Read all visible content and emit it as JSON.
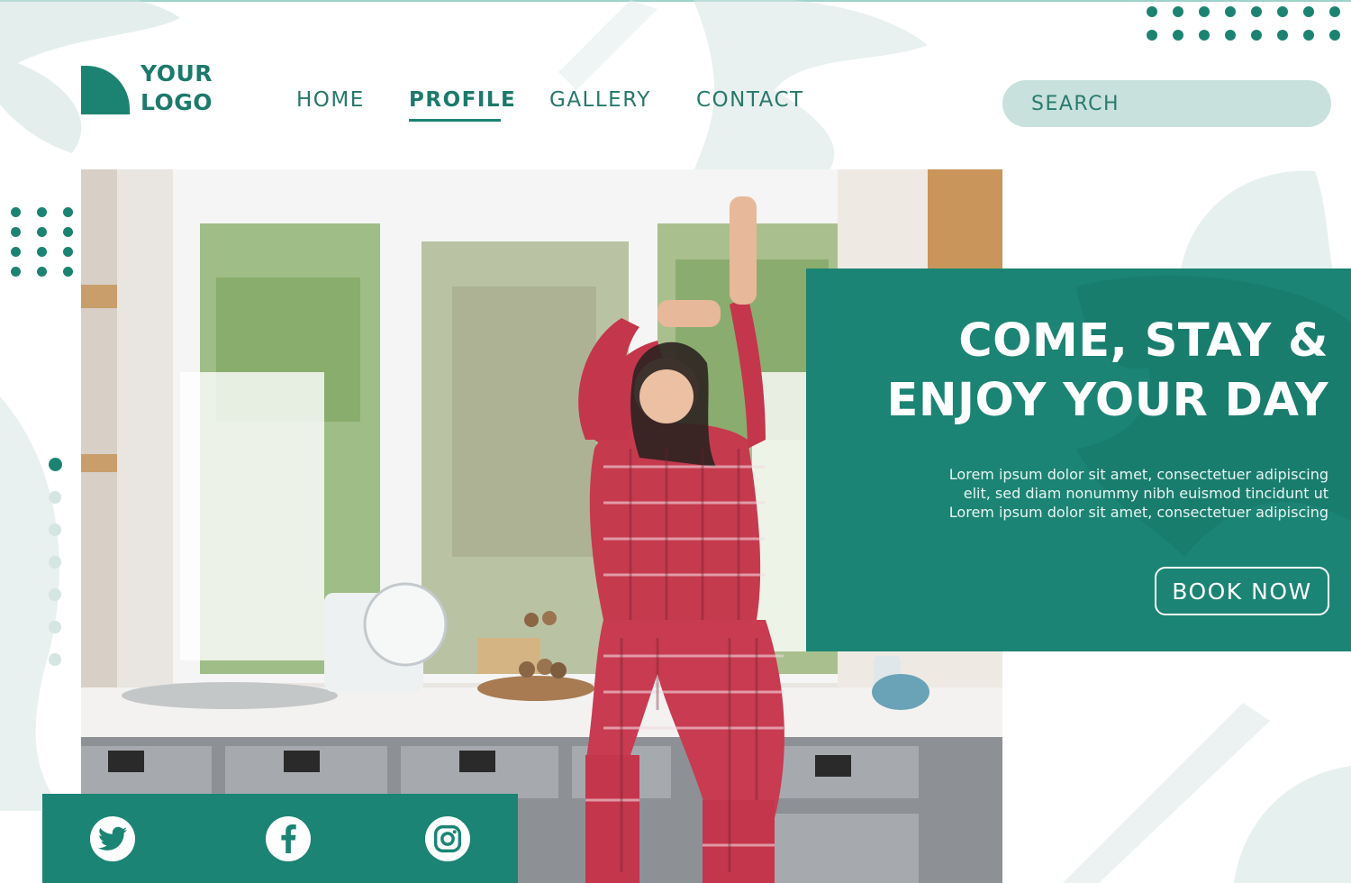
{
  "logo": {
    "line1": "YOUR",
    "line2": "LOGO"
  },
  "nav": {
    "items": [
      {
        "label": "HOME"
      },
      {
        "label": "PROFILE",
        "active": true
      },
      {
        "label": "GALLERY"
      },
      {
        "label": "CONTACT"
      }
    ]
  },
  "search": {
    "placeholder": "SEARCH"
  },
  "hero": {
    "title_line1": "COME, STAY &",
    "title_line2": "ENJOY YOUR DAY",
    "body_line1": "Lorem ipsum dolor sit amet, consectetuer adipiscing",
    "body_line2": "elit, sed diam nonummy nibh euismod tincidunt ut",
    "body_line3": "Lorem ipsum dolor sit amet, consectetuer adipiscing",
    "cta": "BOOK NOW"
  },
  "social": {
    "icons": [
      "twitter-icon",
      "facebook-icon",
      "instagram-icon"
    ]
  },
  "colors": {
    "brand": "#1b8474",
    "text_teal": "#26786b",
    "search_bg": "#c8e1dd",
    "leaf": "#dbe9e6"
  }
}
